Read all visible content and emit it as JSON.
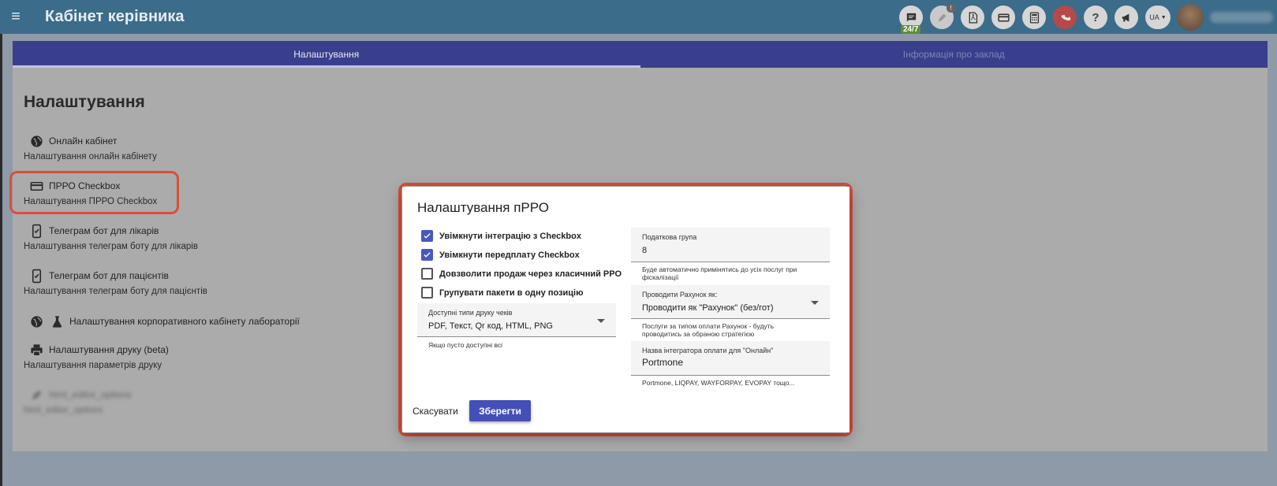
{
  "appbar": {
    "title": "Кабінет керівника",
    "support_badge": "24/7",
    "notification_count": "!",
    "language": "UA",
    "icons": [
      "chat-icon",
      "pen-icon",
      "pdf-icon",
      "credit-card-icon",
      "calculator-icon",
      "phone-hangup-icon",
      "help-icon",
      "megaphone-icon"
    ]
  },
  "tabs": [
    {
      "label": "Налаштування",
      "active": true
    },
    {
      "label": "Інформація про заклад",
      "active": false
    }
  ],
  "page": {
    "heading": "Налаштування",
    "settings": [
      {
        "title": "Онлайн кабінет",
        "subtitle": "Налаштування онлайн кабінету",
        "icon": "globe-icon"
      },
      {
        "title": "ПРРО Checkbox",
        "subtitle": "Налаштування ПРРО Checkbox",
        "icon": "credit-card-icon"
      },
      {
        "title": "Телеграм бот для лікарів",
        "subtitle": "Налаштування телеграм боту для лікарів",
        "icon": "phone-check-icon"
      },
      {
        "title": "Телеграм бот для пацієнтів",
        "subtitle": "Налаштування телеграм боту для пацієнтів",
        "icon": "phone-check-icon"
      },
      {
        "title": "Налаштування корпоративного кабінету лабораторії",
        "subtitle": "",
        "icon": "globe-flask-icon"
      },
      {
        "title": "Налаштування друку (beta)",
        "subtitle": "Налаштування параметрів друку",
        "icon": "printer-icon"
      },
      {
        "title": "html_editor_options",
        "subtitle": "html_editor_options",
        "icon": "pencil-icon"
      }
    ]
  },
  "dialog": {
    "title": "Налаштування пРРО",
    "checkboxes": [
      {
        "label": "Увімкнути інтеграцію з Checkbox",
        "checked": true
      },
      {
        "label": "Увімкнути передплату Checkbox",
        "checked": true
      },
      {
        "label": "Довзволити продаж через класичний РРО",
        "checked": false
      },
      {
        "label": "Групувати пакети в одну позицію",
        "checked": false
      }
    ],
    "print_types": {
      "label": "Доступні типи друку чеків",
      "value": "PDF, Текст, Qr код, HTML, PNG",
      "helper": "Якщо пусто доступні всі"
    },
    "tax_group": {
      "label": "Податкова група",
      "value": "8",
      "helper": "Буде автоматично примінятись до усіх послуг при фіскалізації"
    },
    "invoice_mode": {
      "label": "Проводити Рахунок як:",
      "value": "Проводити як \"Рахунок\" (без/гот)",
      "helper": "Послуги за типом оплати Рахунок - будуть проводитись за обраною стратегією"
    },
    "integrator": {
      "label": "Назва інтегратора оплати для \"Онлайн\"",
      "value": "Portmone",
      "helper": "Portmone, LIQPAY, WAYFORPAY, EVOPAY тощо..."
    },
    "cancel_label": "Скасувати",
    "save_label": "Зберегти"
  },
  "colors": {
    "appbar": "#3b6c8a",
    "tabs": "#393f8c",
    "primary": "#4450b8",
    "highlight": "#d84f3c"
  }
}
